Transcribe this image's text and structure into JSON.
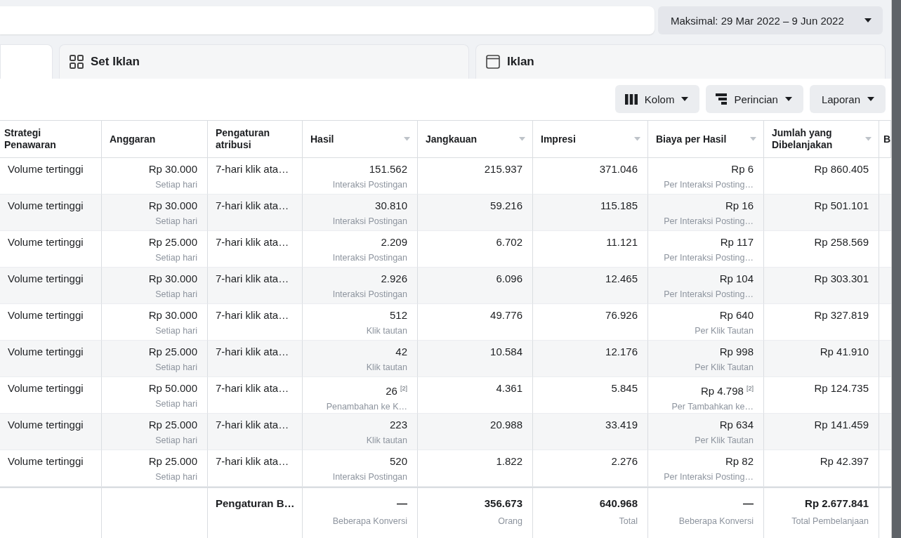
{
  "date_range": {
    "label": "Maksimal: 29 Mar 2022 – 9 Jun 2022"
  },
  "tabs": [
    {
      "kind": "blank",
      "selected": true
    },
    {
      "kind": "grid",
      "label": "Set Iklan",
      "selected": false
    },
    {
      "kind": "frame",
      "label": "Iklan",
      "selected": false
    }
  ],
  "toolbar": [
    {
      "kind": "columns",
      "label": "Kolom"
    },
    {
      "kind": "breakdown",
      "label": "Perincian"
    },
    {
      "kind": "plain",
      "label": "Laporan"
    }
  ],
  "table": {
    "columns": [
      {
        "label": "Strategi Penawaran",
        "sortable": false
      },
      {
        "label": "Anggaran",
        "sortable": false
      },
      {
        "label": "Pengaturan atribusi",
        "sortable": false
      },
      {
        "label": "Hasil",
        "sortable": true
      },
      {
        "label": "Jangkauan",
        "sortable": true
      },
      {
        "label": "Impresi",
        "sortable": true
      },
      {
        "label": "Biaya per Hasil",
        "sortable": true
      },
      {
        "label": "Jumlah yang Dibelanjakan",
        "sortable": true
      },
      {
        "label": "B",
        "sortable": false
      }
    ],
    "rows": [
      {
        "cells": [
          {
            "value": "Volume tertinggi"
          },
          {
            "value": "Rp 30.000",
            "sub": "Setiap hari"
          },
          {
            "value": "7-hari klik ata…"
          },
          {
            "value": "151.562",
            "sub": "Interaksi Postingan"
          },
          {
            "value": "215.937"
          },
          {
            "value": "371.046"
          },
          {
            "value": "Rp 6",
            "sub": "Per Interaksi Posting…"
          },
          {
            "value": "Rp 860.405"
          }
        ]
      },
      {
        "cells": [
          {
            "value": "Volume tertinggi"
          },
          {
            "value": "Rp 30.000",
            "sub": "Setiap hari"
          },
          {
            "value": "7-hari klik ata…"
          },
          {
            "value": "30.810",
            "sub": "Interaksi Postingan"
          },
          {
            "value": "59.216"
          },
          {
            "value": "115.185"
          },
          {
            "value": "Rp 16",
            "sub": "Per Interaksi Posting…"
          },
          {
            "value": "Rp 501.101"
          }
        ]
      },
      {
        "cells": [
          {
            "value": "Volume tertinggi"
          },
          {
            "value": "Rp 25.000",
            "sub": "Setiap hari"
          },
          {
            "value": "7-hari klik ata…"
          },
          {
            "value": "2.209",
            "sub": "Interaksi Postingan"
          },
          {
            "value": "6.702"
          },
          {
            "value": "11.121"
          },
          {
            "value": "Rp 117",
            "sub": "Per Interaksi Posting…"
          },
          {
            "value": "Rp 258.569"
          }
        ]
      },
      {
        "cells": [
          {
            "value": "Volume tertinggi"
          },
          {
            "value": "Rp 30.000",
            "sub": "Setiap hari"
          },
          {
            "value": "7-hari klik ata…"
          },
          {
            "value": "2.926",
            "sub": "Interaksi Postingan"
          },
          {
            "value": "6.096"
          },
          {
            "value": "12.465"
          },
          {
            "value": "Rp 104",
            "sub": "Per Interaksi Posting…"
          },
          {
            "value": "Rp 303.301"
          }
        ]
      },
      {
        "cells": [
          {
            "value": "Volume tertinggi"
          },
          {
            "value": "Rp 30.000",
            "sub": "Setiap hari"
          },
          {
            "value": "7-hari klik ata…"
          },
          {
            "value": "512",
            "sub": "Klik tautan"
          },
          {
            "value": "49.776"
          },
          {
            "value": "76.926"
          },
          {
            "value": "Rp 640",
            "sub": "Per Klik Tautan"
          },
          {
            "value": "Rp 327.819"
          }
        ]
      },
      {
        "cells": [
          {
            "value": "Volume tertinggi"
          },
          {
            "value": "Rp 25.000",
            "sub": "Setiap hari"
          },
          {
            "value": "7-hari klik ata…"
          },
          {
            "value": "42",
            "sub": "Klik tautan"
          },
          {
            "value": "10.584"
          },
          {
            "value": "12.176"
          },
          {
            "value": "Rp 998",
            "sub": "Per Klik Tautan"
          },
          {
            "value": "Rp 41.910"
          }
        ]
      },
      {
        "cells": [
          {
            "value": "Volume tertinggi"
          },
          {
            "value": "Rp 50.000",
            "sub": "Setiap hari"
          },
          {
            "value": "7-hari klik ata…"
          },
          {
            "value": "26 $^{[2]}$",
            "sub": "Penambahan ke K…"
          },
          {
            "value": "4.361"
          },
          {
            "value": "5.845"
          },
          {
            "value": "Rp 4.798 $^{[2]}$",
            "sub": "Per Tambahkan ke…"
          },
          {
            "value": "Rp 124.735"
          }
        ]
      },
      {
        "cells": [
          {
            "value": "Volume tertinggi"
          },
          {
            "value": "Rp 25.000",
            "sub": "Setiap hari"
          },
          {
            "value": "7-hari klik ata…"
          },
          {
            "value": "223",
            "sub": "Klik tautan"
          },
          {
            "value": "20.988"
          },
          {
            "value": "33.419"
          },
          {
            "value": "Rp 634",
            "sub": "Per Klik Tautan"
          },
          {
            "value": "Rp 141.459"
          }
        ]
      },
      {
        "cells": [
          {
            "value": "Volume tertinggi"
          },
          {
            "value": "Rp 25.000",
            "sub": "Setiap hari"
          },
          {
            "value": "7-hari klik ata…"
          },
          {
            "value": "520",
            "sub": "Interaksi Postingan"
          },
          {
            "value": "1.822"
          },
          {
            "value": "2.276"
          },
          {
            "value": "Rp 82",
            "sub": "Per Interaksi Posting…"
          },
          {
            "value": "Rp 42.397"
          }
        ]
      }
    ],
    "totals": [
      {
        "value": "Pengaturan B…"
      },
      {
        "value": "—",
        "sub": "Beberapa Konversi"
      },
      {
        "value": "356.673",
        "sub": "Orang"
      },
      {
        "value": "640.968",
        "sub": "Total"
      },
      {
        "value": "—",
        "sub": "Beberapa Konversi"
      },
      {
        "value": "Rp 2.677.841",
        "sub": "Total Pembelanjaan"
      }
    ]
  }
}
